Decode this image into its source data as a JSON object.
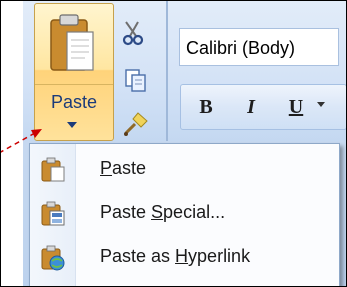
{
  "ribbon": {
    "paste_label": "Paste",
    "font_name": "Calibri (Body)",
    "format_buttons": {
      "bold": "B",
      "italic": "I",
      "underline": "U"
    }
  },
  "menu": {
    "items": [
      {
        "pre": "",
        "u": "P",
        "post": "aste"
      },
      {
        "pre": "Paste ",
        "u": "S",
        "post": "pecial..."
      },
      {
        "pre": "Paste as ",
        "u": "H",
        "post": "yperlink"
      }
    ]
  },
  "icons": [
    "clipboard-icon",
    "scissors-icon",
    "copy-icon",
    "format-painter-icon",
    "paste-icon",
    "paste-special-icon",
    "paste-hyperlink-icon",
    "dropdown-arrow-icon"
  ],
  "colors": {
    "menu_border": "#8ea8c8",
    "paste_highlight": "#ffd37a",
    "annotation_arrow": "#cc0000"
  }
}
